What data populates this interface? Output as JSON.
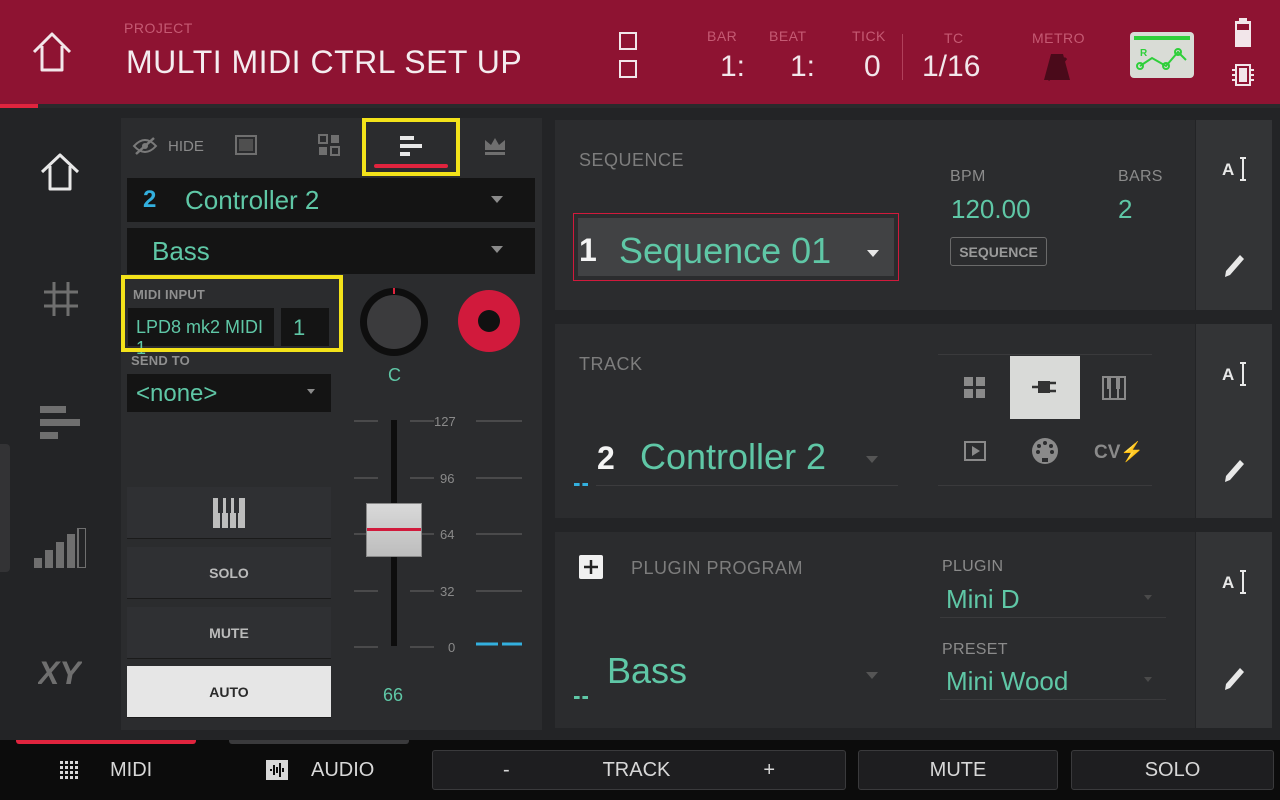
{
  "header": {
    "project_label": "PROJECT",
    "project_name": "MULTI MIDI CTRL SET UP",
    "bar_label": "BAR",
    "bar_value": "1:",
    "beat_label": "BEAT",
    "beat_value": "1:",
    "tick_label": "TICK",
    "tick_value": "0",
    "tc_label": "TC",
    "tc_value": "1/16",
    "metro_label": "METRO"
  },
  "left_panel": {
    "hide_label": "HIDE",
    "track_number": "2",
    "track_name": "Controller 2",
    "program_name": "Bass",
    "midi_input_label": "MIDI INPUT",
    "midi_input_value": "LPD8 mk2 MIDI 1",
    "midi_channel_value": "1",
    "send_to_label": "SEND TO",
    "send_to_value": "<none>",
    "knob_label": "C",
    "solo_label": "SOLO",
    "mute_label": "MUTE",
    "auto_label": "AUTO",
    "fader_value": "66",
    "scale": [
      "127",
      "96",
      "64",
      "32",
      "0"
    ]
  },
  "sequence_panel": {
    "label": "SEQUENCE",
    "number": "1",
    "name": "Sequence 01",
    "bpm_label": "BPM",
    "bpm_value": "120.00",
    "bars_label": "BARS",
    "bars_value": "2",
    "sequence_button": "SEQUENCE"
  },
  "track_panel": {
    "label": "TRACK",
    "number": "2",
    "name": "Controller 2",
    "cv_label": "CV⚡"
  },
  "plugin_panel": {
    "label": "PLUGIN PROGRAM",
    "program_name": "Bass",
    "plugin_label": "PLUGIN",
    "plugin_value": "Mini D",
    "preset_label": "PRESET",
    "preset_value": "Mini Wood"
  },
  "bottom_bar": {
    "midi_label": "MIDI",
    "audio_label": "AUDIO",
    "track_minus": "-",
    "track_label": "TRACK",
    "track_plus": "+",
    "mute_label": "MUTE",
    "solo_label": "SOLO"
  },
  "colors": {
    "header_red": "#8e1332",
    "accent_red": "#e0243e",
    "teal_text": "#5fc7a6",
    "blue_number": "#33b0df",
    "highlight_yellow": "#f3e21a",
    "status_green": "#2fcf3a"
  }
}
